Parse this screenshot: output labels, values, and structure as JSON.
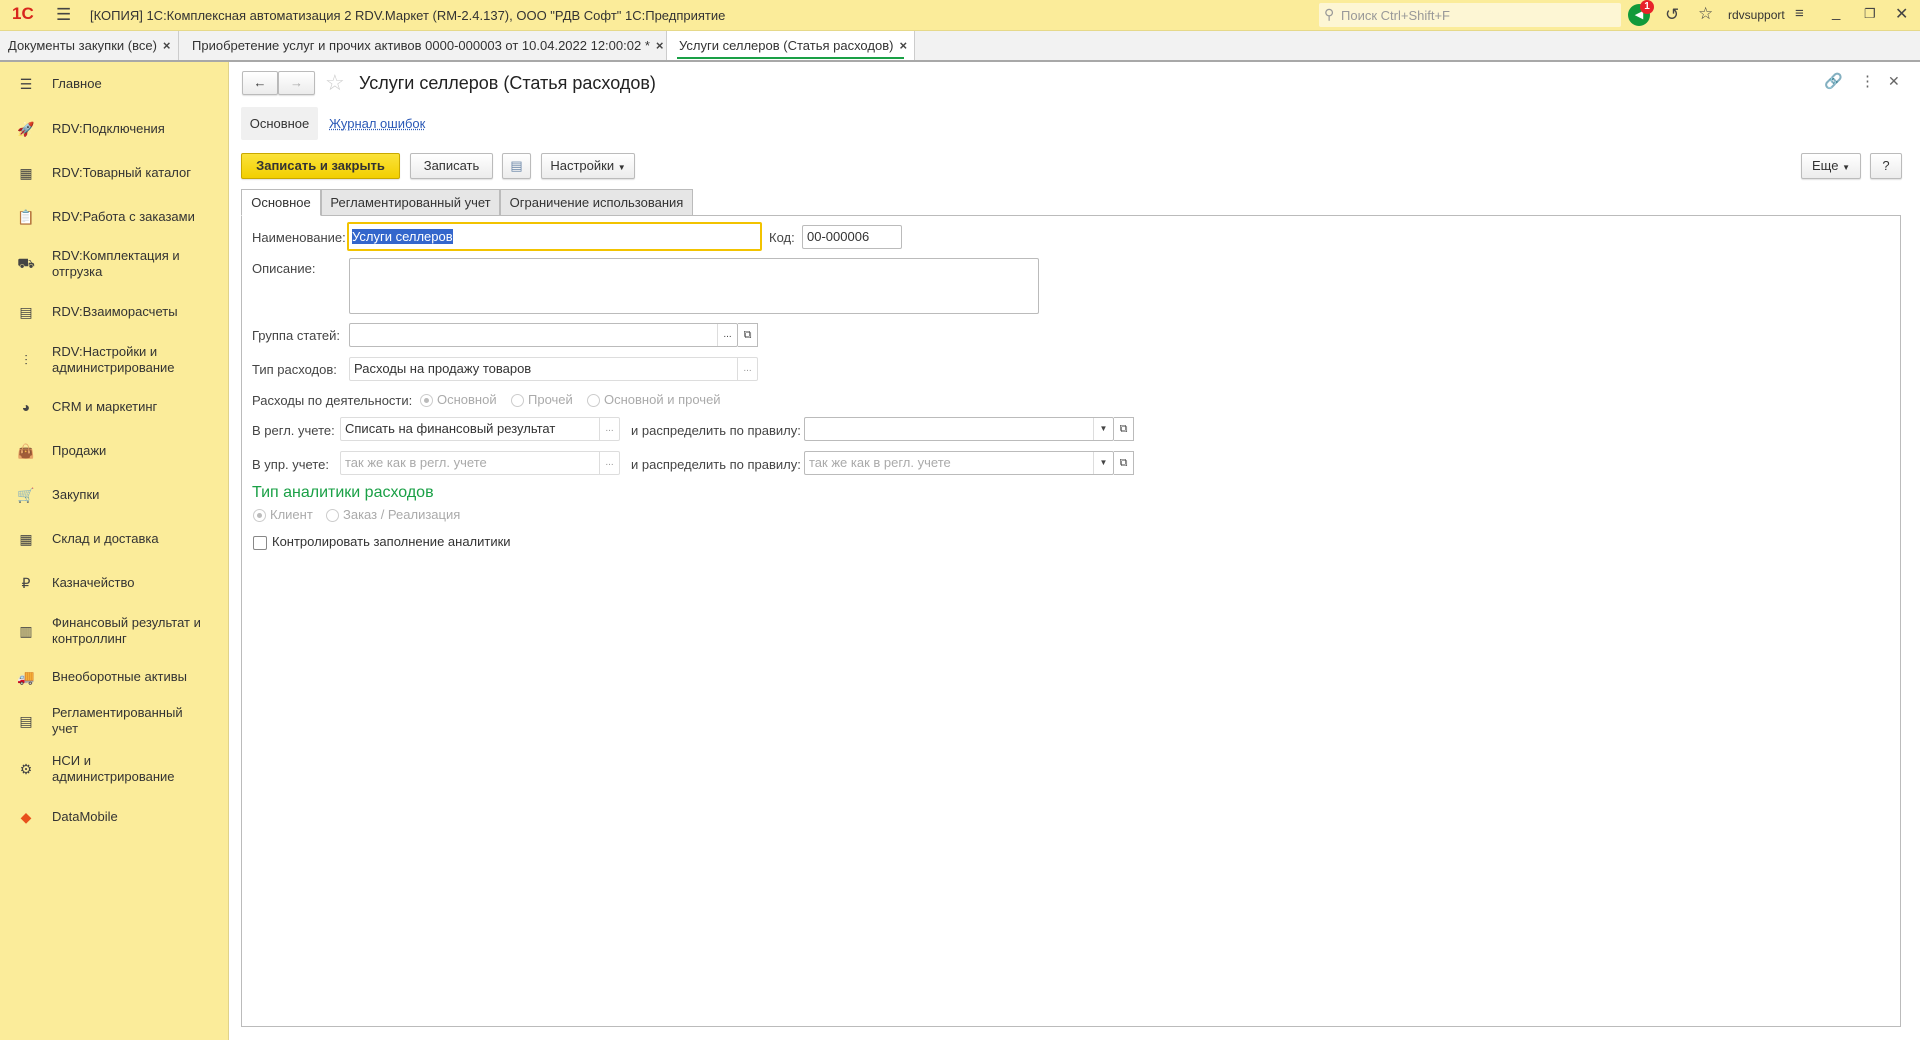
{
  "titlebar": {
    "logo": "1С",
    "title": "[КОПИЯ] 1С:Комплексная автоматизация 2 RDV.Маркет (RM-2.4.137), ООО \"РДВ Софт\" 1С:Предприятие",
    "search_placeholder": "Поиск Ctrl+Shift+F",
    "notification_count": "1",
    "user": "rdvsupport"
  },
  "open_tabs": [
    {
      "label": "Документы закупки (все)"
    },
    {
      "label": "Приобретение услуг и прочих активов 0000-000003 от 10.04.2022 12:00:02 *"
    },
    {
      "label": "Услуги селлеров (Статья расходов)"
    }
  ],
  "close_glyph": "×",
  "sidebar": {
    "items": [
      {
        "label": "Главное",
        "icon": "☰"
      },
      {
        "label": "RDV:Подключения",
        "icon": "🚀"
      },
      {
        "label": "RDV:Товарный каталог",
        "icon": "▦"
      },
      {
        "label": "RDV:Работа с заказами",
        "icon": "📋"
      },
      {
        "label": "RDV:Комплектация и отгрузка",
        "icon": "⛟"
      },
      {
        "label": "RDV:Взаиморасчеты",
        "icon": "▤"
      },
      {
        "label": "RDV:Настройки и администрирование",
        "icon": "⫶"
      },
      {
        "label": "CRM и маркетинг",
        "icon": "◕"
      },
      {
        "label": "Продажи",
        "icon": "👜"
      },
      {
        "label": "Закупки",
        "icon": "🛒"
      },
      {
        "label": "Склад и доставка",
        "icon": "▦"
      },
      {
        "label": "Казначейство",
        "icon": "₽"
      },
      {
        "label": "Финансовый результат и контроллинг",
        "icon": "▥"
      },
      {
        "label": "Внеоборотные активы",
        "icon": "🚚"
      },
      {
        "label": "Регламентированный учет",
        "icon": "▤"
      },
      {
        "label": "НСИ и администрирование",
        "icon": "⚙"
      },
      {
        "label": "DataMobile",
        "icon": "◆"
      }
    ]
  },
  "form": {
    "title": "Услуги селлеров (Статья расходов)",
    "subnav": {
      "main": "Основное",
      "errors_link": "Журнал ошибок"
    },
    "toolbar": {
      "save_close": "Записать и закрыть",
      "save": "Записать",
      "settings": "Настройки",
      "more": "Еще",
      "help": "?"
    },
    "tabs": [
      "Основное",
      "Регламентированный учет",
      "Ограничение использования"
    ],
    "fields": {
      "name_label": "Наименование:",
      "name_value": "Услуги селлеров",
      "code_label": "Код:",
      "code_value": "00-000006",
      "desc_label": "Описание:",
      "desc_value": "",
      "group_label": "Группа статей:",
      "group_value": "",
      "type_label": "Тип расходов:",
      "type_value": "Расходы на продажу товаров",
      "activity_label": "Расходы по деятельности:",
      "activity_options": [
        "Основной",
        "Прочей",
        "Основной и прочей"
      ],
      "reg_label": "В регл. учете:",
      "reg_value": "Списать на финансовый результат",
      "distribute_label": "и распределить по правилу:",
      "reg_rule_value": "",
      "mgmt_label": "В упр. учете:",
      "mgmt_placeholder": "так же как в регл. учете",
      "mgmt_rule_placeholder": "так же как в регл. учете",
      "analytics_heading": "Тип аналитики расходов",
      "analytics_options": [
        "Клиент",
        "Заказ / Реализация"
      ],
      "control_checkbox": "Контролировать заполнение аналитики"
    }
  },
  "colors": {
    "accent_yellow": "#fbec9a",
    "save_button": "#f5d400",
    "green_heading": "#1aa046",
    "link": "#2a58b6"
  }
}
